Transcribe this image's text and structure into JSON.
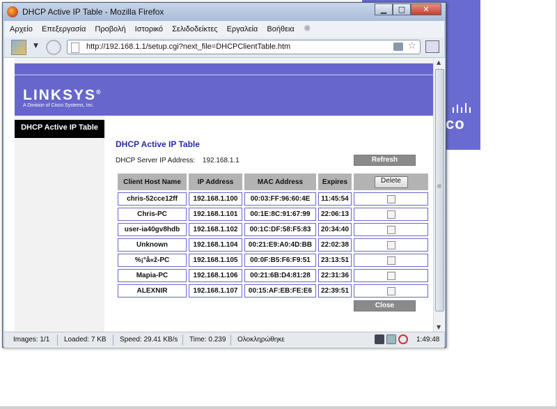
{
  "window": {
    "title": "DHCP Active IP Table - Mozilla Firefox",
    "buttons": {
      "minimize": "▁",
      "maximize": "□",
      "close": "✕"
    }
  },
  "menu": [
    "Αρχείο",
    "Επεξεργασία",
    "Προβολή",
    "Ιστορικό",
    "Σελιδοδείκτες",
    "Εργαλεία",
    "Βοήθεια"
  ],
  "address_bar": {
    "url": "http://192.168.1.1/setup.cgi?next_file=DHCPClientTable.htm"
  },
  "page": {
    "logo": "LINKSYS",
    "logo_mark": "®",
    "logo_sub": "A Division of Cisco Systems, Inc.",
    "sidebar_tab": "DHCP Active IP Table",
    "title": "DHCP Active IP Table",
    "server_label": "DHCP Server IP Address:",
    "server_ip": "192.168.1.1",
    "refresh_label": "Refresh",
    "close_label": "Close",
    "delete_label": "Delete",
    "columns": [
      "Client Host Name",
      "IP Address",
      "MAC Address",
      "Expires"
    ],
    "rows": [
      {
        "host": "chris-52cce12ff",
        "ip": "192.168.1.100",
        "mac": "00:03:FF:96:60:4E",
        "expires": "11:45:54"
      },
      {
        "host": "Chris-PC",
        "ip": "192.168.1.101",
        "mac": "00:1E:8C:91:67:99",
        "expires": "22:06:13"
      },
      {
        "host": "user-ia40gv8hdb",
        "ip": "192.168.1.102",
        "mac": "00:1C:DF:58:F5:83",
        "expires": "20:34:40"
      },
      {
        "host": "Unknown",
        "ip": "192.168.1.104",
        "mac": "00:21:E9:A0:4D:BB",
        "expires": "22:02:38"
      },
      {
        "host": "%¡°å«ž-PC",
        "ip": "192.168.1.105",
        "mac": "00:0F:B5:F6:F9:51",
        "expires": "23:13:51"
      },
      {
        "host": "Mapia-PC",
        "ip": "192.168.1.106",
        "mac": "00:21:6B:D4:81:28",
        "expires": "22:31:36"
      },
      {
        "host": "ALEXNIR",
        "ip": "192.168.1.107",
        "mac": "00:15:AF:EB:FE:E6",
        "expires": "22:39:51"
      }
    ]
  },
  "statusbar": {
    "images": "Images: 1/1",
    "loaded": "Loaded: 7 KB",
    "speed": "Speed: 29.41 KB/s",
    "time": "Time: 0.239",
    "state": "Ολοκληρώθηκε",
    "clock": "1:49:48"
  },
  "background": {
    "panel_text": "co"
  },
  "colors": {
    "banner": "#6666cc",
    "title_blue": "#2a2aa8",
    "cell_border": "#6666cc",
    "gray_button": "#8a8a8a"
  }
}
